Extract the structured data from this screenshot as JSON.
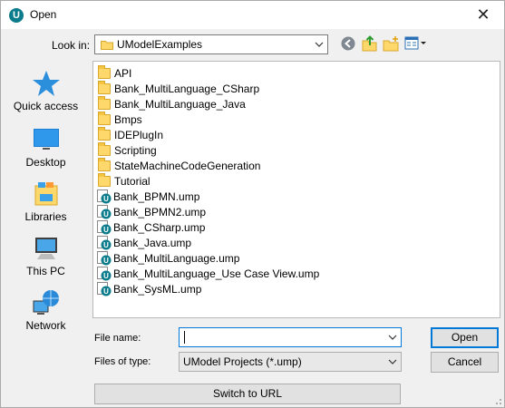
{
  "window": {
    "title": "Open",
    "close_glyph": "✕"
  },
  "lookin": {
    "label": "Look in:",
    "value": "UModelExamples"
  },
  "places": [
    {
      "label": "Quick access",
      "icon": "star-icon"
    },
    {
      "label": "Desktop",
      "icon": "desktop-icon"
    },
    {
      "label": "Libraries",
      "icon": "libraries-icon"
    },
    {
      "label": "This PC",
      "icon": "computer-icon"
    },
    {
      "label": "Network",
      "icon": "network-icon"
    }
  ],
  "files": {
    "folders": [
      "API",
      "Bank_MultiLanguage_CSharp",
      "Bank_MultiLanguage_Java",
      "Bmps",
      "IDEPlugIn",
      "Scripting",
      "StateMachineCodeGeneration",
      "Tutorial"
    ],
    "ump_files": [
      "Bank_BPMN.ump",
      "Bank_BPMN2.ump",
      "Bank_CSharp.ump",
      "Bank_Java.ump",
      "Bank_MultiLanguage.ump",
      "Bank_MultiLanguage_Use Case View.ump",
      "Bank_SysML.ump"
    ]
  },
  "filename": {
    "label": "File name:",
    "value": ""
  },
  "filetype": {
    "label": "Files of type:",
    "value": "UModel Projects (*.ump)"
  },
  "buttons": {
    "open": "Open",
    "cancel": "Cancel",
    "switch_url": "Switch to URL"
  },
  "colors": {
    "accent": "#0078d7",
    "folder": "#ffd86b"
  }
}
